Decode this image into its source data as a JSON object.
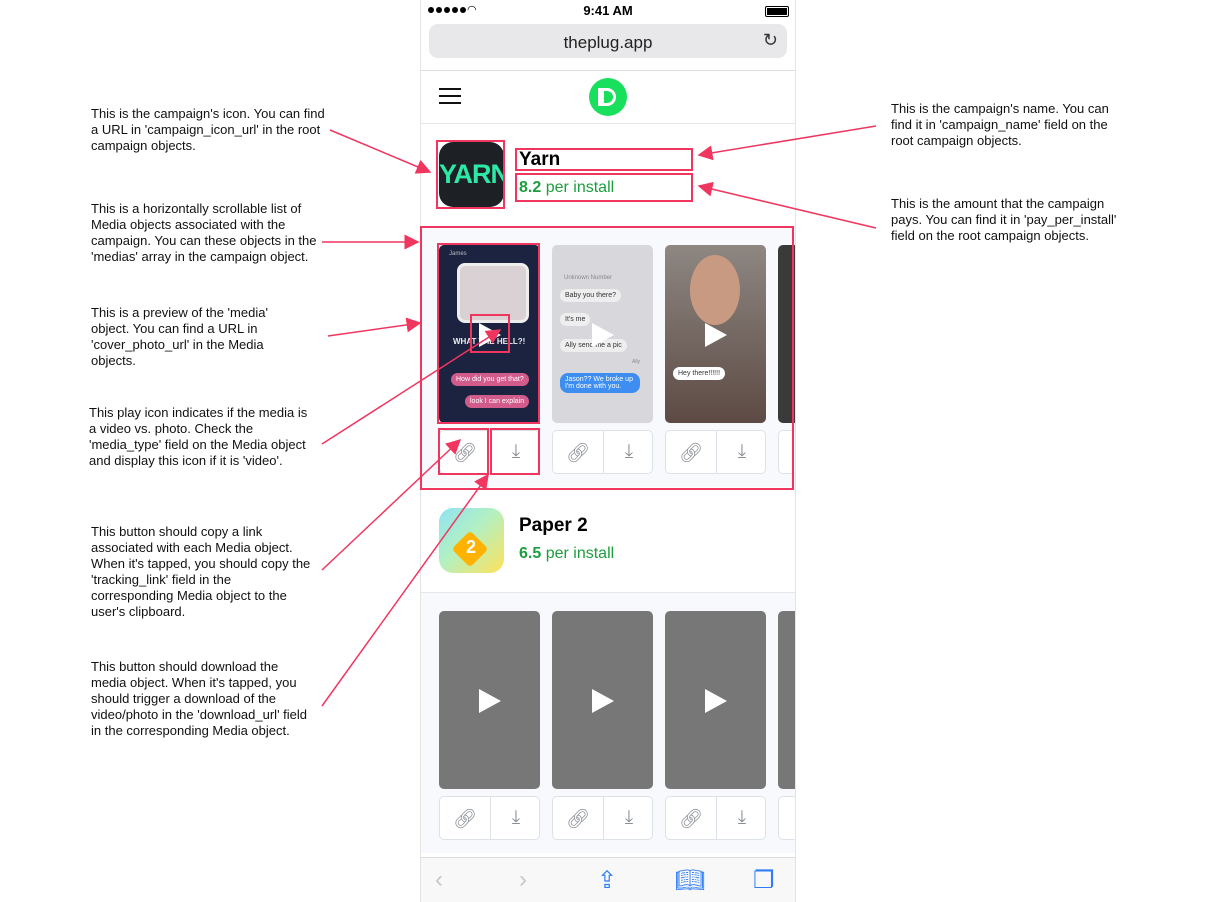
{
  "status_bar": {
    "time": "9:41 AM"
  },
  "browser": {
    "url": "theplug.app"
  },
  "campaigns": [
    {
      "name": "Yarn",
      "pay_amount": "8.2",
      "pay_suffix": "per install",
      "icon_text": "YARN"
    },
    {
      "name": "Paper 2",
      "pay_amount": "6.5",
      "pay_suffix": "per install",
      "icon_text": "2"
    }
  ],
  "yarn_chat": {
    "card1": {
      "contact": "James",
      "caption": "WHAT THE HELL?!",
      "bubbles": [
        "How did you get that?",
        "look I can explain"
      ]
    },
    "card2": {
      "contact": "Unknown Number",
      "bubbles": [
        "Baby you there?",
        "It's me",
        "Ally send me a pic",
        "Jason?? We broke up I'm done with you."
      ],
      "sender": "Ally"
    },
    "card3": {
      "bubble": "Hey there!!!!!!"
    }
  },
  "annotations": {
    "icon": "This is the campaign's icon. You can find a URL in 'campaign_icon_url' in the root campaign objects.",
    "name": "This is the campaign's name. You can find it in 'campaign_name' field on the root campaign objects.",
    "pay": "This is the amount that the campaign pays. You can find it in 'pay_per_install' field on the root campaign objects.",
    "medias": "This is a horizontally scrollable list of Media objects associated with the campaign. You can these objects in the 'medias' array in the campaign object.",
    "preview": "This is a preview of the 'media' object. You can find a URL in 'cover_photo_url' in the Media objects.",
    "play": "This play icon indicates if the media is a video vs. photo. Check the 'media_type' field on the Media object and display this icon if it is 'video'.",
    "copy": "This button should copy a link associated with each Media object. When it's tapped, you should copy the 'tracking_link' field in the corresponding Media object to the user's clipboard.",
    "download": "This button should download the media object. When it's tapped, you should trigger a download of the video/photo in the 'download_url' field in the corresponding Media object."
  },
  "icons": {
    "link": "link-icon",
    "download": "download-icon",
    "play": "play-icon",
    "back": "chevron-left-icon",
    "forward": "chevron-right-icon",
    "share": "share-icon",
    "bookmarks": "book-icon",
    "tabs": "tabs-icon",
    "reload": "reload-icon",
    "menu": "hamburger-icon"
  },
  "colors": {
    "accent_green": "#1d9e3e",
    "logo_green": "#19e05c",
    "annotation_red": "#f0365f",
    "ios_blue": "#2f7df6"
  }
}
